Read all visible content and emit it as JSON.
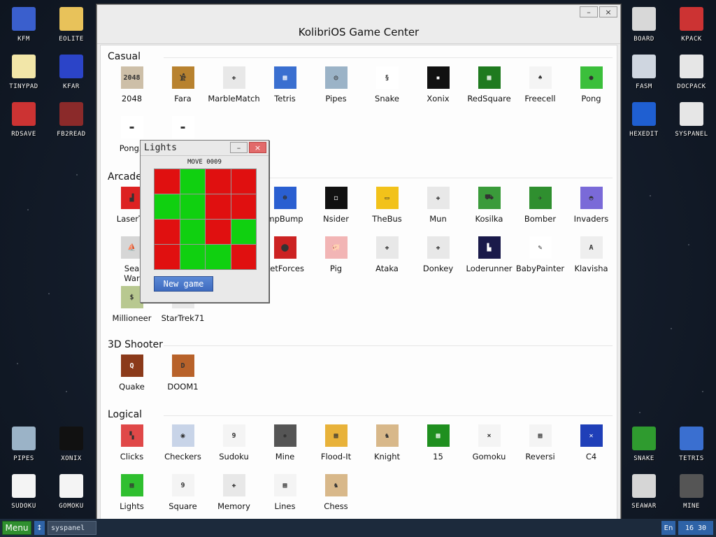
{
  "desktop": {
    "left_icons": [
      {
        "label": "KFM",
        "icon": "floppy-icon",
        "color": "#3a5fcd"
      },
      {
        "label": "EOLITE",
        "icon": "folder-icon",
        "color": "#e8c25a"
      },
      {
        "label": "TINYPAD",
        "icon": "notepad-icon",
        "color": "#f2e6a8"
      },
      {
        "label": "KFAR",
        "icon": "kfar-icon",
        "color": "#2b44c8"
      },
      {
        "label": "RDSAVE",
        "icon": "rdsave-icon",
        "color": "#c33"
      },
      {
        "label": "FB2READ",
        "icon": "book-icon",
        "color": "#8b2a2a"
      },
      {
        "label": "PIPES",
        "icon": "pipes-icon",
        "color": "#9bb3c7"
      },
      {
        "label": "XONIX",
        "icon": "xonix-icon",
        "color": "#111"
      },
      {
        "label": "SUDOKU",
        "icon": "sudoku-icon",
        "color": "#f4f4f4"
      },
      {
        "label": "GOMOKU",
        "icon": "gomoku-icon",
        "color": "#f4f4f4"
      }
    ],
    "right_icons": [
      {
        "label": "BOARD",
        "icon": "board-icon",
        "color": "#d8d8d8"
      },
      {
        "label": "KPACK",
        "icon": "hammer-icon",
        "color": "#c33"
      },
      {
        "label": "FASM",
        "icon": "fasm-icon",
        "color": "#cfd6e0"
      },
      {
        "label": "DOCPACK",
        "icon": "docpack-icon",
        "color": "#e6e6e6"
      },
      {
        "label": "HEXEDIT",
        "icon": "hexedit-icon",
        "color": "#1f5fd1"
      },
      {
        "label": "SYSPANEL",
        "icon": "syspanel-icon",
        "color": "#e6e6e6"
      },
      {
        "label": "SNAKE",
        "icon": "snake-icon",
        "color": "#2f9b2f"
      },
      {
        "label": "TETRIS",
        "icon": "tetris-icon",
        "color": "#3a6fd0"
      },
      {
        "label": "SEAWAR",
        "icon": "seawar-icon",
        "color": "#d6d6d6"
      },
      {
        "label": "MINE",
        "icon": "mine-icon",
        "color": "#555"
      }
    ]
  },
  "game_center": {
    "title": "KolibriOS Game Center",
    "window_buttons": {
      "minimize": "–",
      "close": "×"
    },
    "sections": [
      {
        "title": "Casual",
        "apps": [
          {
            "label": "2048",
            "icon": "2048-icon",
            "color": "#cdbfa8",
            "glyph": "2048"
          },
          {
            "label": "Fara",
            "icon": "fara-icon",
            "color": "#b8822f",
            "glyph": "𓀀"
          },
          {
            "label": "MarbleMatch",
            "icon": "gamepad-icon",
            "color": "#e8e8e8",
            "glyph": "✚"
          },
          {
            "label": "Tetris",
            "icon": "tetris-icon",
            "color": "#3a6fd0",
            "glyph": "▦"
          },
          {
            "label": "Pipes",
            "icon": "pipes-icon",
            "color": "#9bb3c7",
            "glyph": "◎"
          },
          {
            "label": "Snake",
            "icon": "snake-icon",
            "color": "#ffffff",
            "glyph": "§"
          },
          {
            "label": "Xonix",
            "icon": "xonix-icon",
            "color": "#111111",
            "glyph": "▪"
          },
          {
            "label": "RedSquare",
            "icon": "redsquare-icon",
            "color": "#1f7a1f",
            "glyph": "▩"
          },
          {
            "label": "Freecell",
            "icon": "cards-icon",
            "color": "#f4f4f4",
            "glyph": "♠"
          },
          {
            "label": "Pong",
            "icon": "ball-icon",
            "color": "#3bbf3b",
            "glyph": "●"
          },
          {
            "label": "Pong3",
            "icon": "paddle-icon",
            "color": "#ffffff",
            "glyph": "▬"
          },
          {
            "label": "",
            "icon": "paddle-icon",
            "color": "#ffffff",
            "glyph": "▬"
          }
        ]
      },
      {
        "title": "Arcade",
        "apps": [
          {
            "label": "LaserTa",
            "icon": "tank-icon",
            "color": "#d22",
            "glyph": "▟"
          },
          {
            "label": "",
            "icon": "blank-icon",
            "color": "#ffffff",
            "glyph": ""
          },
          {
            "label": "",
            "icon": "blank-icon",
            "color": "#ffffff",
            "glyph": ""
          },
          {
            "label": "mpBump",
            "icon": "bump-icon",
            "color": "#2a5fd1",
            "glyph": "☻"
          },
          {
            "label": "Nsider",
            "icon": "nsider-icon",
            "color": "#111111",
            "glyph": "◻"
          },
          {
            "label": "TheBus",
            "icon": "bus-icon",
            "color": "#f2c21a",
            "glyph": "▭"
          },
          {
            "label": "Mun",
            "icon": "gamepad-icon",
            "color": "#e8e8e8",
            "glyph": "✚"
          },
          {
            "label": "Kosilka",
            "icon": "mower-icon",
            "color": "#3a9b3a",
            "glyph": "⛟"
          },
          {
            "label": "Bomber",
            "icon": "plane-icon",
            "color": "#2f8f2f",
            "glyph": "✈"
          },
          {
            "label": "Invaders",
            "icon": "ufo-icon",
            "color": "#7a6ad8",
            "glyph": "◓"
          },
          {
            "label": "Sea\nWar",
            "icon": "ship-icon",
            "color": "#d6d6d6",
            "glyph": "⛵"
          },
          {
            "label": "",
            "icon": "blank-icon",
            "color": "#ffffff",
            "glyph": ""
          },
          {
            "label": "",
            "icon": "blank-icon",
            "color": "#ffffff",
            "glyph": ""
          },
          {
            "label": "ketForces",
            "icon": "rocket-icon",
            "color": "#c22",
            "glyph": "⬤"
          },
          {
            "label": "Pig",
            "icon": "pig-icon",
            "color": "#f2b5b5",
            "glyph": "🐖"
          },
          {
            "label": "Ataka",
            "icon": "gamepad-icon",
            "color": "#e8e8e8",
            "glyph": "✚"
          },
          {
            "label": "Donkey",
            "icon": "gamepad-icon",
            "color": "#e8e8e8",
            "glyph": "✚"
          },
          {
            "label": "Loderunner",
            "icon": "loderunner-icon",
            "color": "#1a1a4a",
            "glyph": "▙"
          },
          {
            "label": "BabyPainter",
            "icon": "brush-icon",
            "color": "#ffffff",
            "glyph": "✎"
          },
          {
            "label": "Klavisha",
            "icon": "key-icon",
            "color": "#eeeeee",
            "glyph": "A"
          },
          {
            "label": "Millioneer",
            "icon": "money-icon",
            "color": "#b8c890",
            "glyph": "$"
          },
          {
            "label": "StarTrek71",
            "icon": "startrek-icon",
            "color": "#e8e8e8",
            "glyph": "✦"
          }
        ]
      },
      {
        "title": "3D Shooter",
        "apps": [
          {
            "label": "Quake",
            "icon": "quake-icon",
            "color": "#8b3a1a",
            "glyph": "Q"
          },
          {
            "label": "DOOM1",
            "icon": "doom-icon",
            "color": "#b8622a",
            "glyph": "D"
          }
        ]
      },
      {
        "title": "Logical",
        "apps": [
          {
            "label": "Clicks",
            "icon": "clicks-icon",
            "color": "#e04848",
            "glyph": "▚"
          },
          {
            "label": "Checkers",
            "icon": "checkers-icon",
            "color": "#c8d4e8",
            "glyph": "◉"
          },
          {
            "label": "Sudoku",
            "icon": "sudoku-icon",
            "color": "#f4f4f4",
            "glyph": "9"
          },
          {
            "label": "Mine",
            "icon": "mine-icon",
            "color": "#555555",
            "glyph": "✹"
          },
          {
            "label": "Flood-It",
            "icon": "flood-icon",
            "color": "#e8b23a",
            "glyph": "▦"
          },
          {
            "label": "Knight",
            "icon": "knight-icon",
            "color": "#d8b88a",
            "glyph": "♞"
          },
          {
            "label": "15",
            "icon": "fifteen-icon",
            "color": "#1f8f1f",
            "glyph": "▦"
          },
          {
            "label": "Gomoku",
            "icon": "gomoku-icon",
            "color": "#f4f4f4",
            "glyph": "⨯"
          },
          {
            "label": "Reversi",
            "icon": "reversi-icon",
            "color": "#f4f4f4",
            "glyph": "▦"
          },
          {
            "label": "C4",
            "icon": "c4-icon",
            "color": "#1f3fb8",
            "glyph": "✕"
          },
          {
            "label": "Lights",
            "icon": "lights-icon",
            "color": "#2fbf2f",
            "glyph": "▦"
          },
          {
            "label": "Square",
            "icon": "square-icon",
            "color": "#f4f4f4",
            "glyph": "9"
          },
          {
            "label": "Memory",
            "icon": "gamepad-icon",
            "color": "#e8e8e8",
            "glyph": "✚"
          },
          {
            "label": "Lines",
            "icon": "lines-icon",
            "color": "#f4f4f4",
            "glyph": "▦"
          },
          {
            "label": "Chess",
            "icon": "chess-icon",
            "color": "#d8b88a",
            "glyph": "♞"
          }
        ]
      }
    ]
  },
  "lights_window": {
    "title": "Lights",
    "window_buttons": {
      "minimize": "–",
      "close": "×"
    },
    "move_label": "MOVE 0009",
    "new_game_label": "New game",
    "colors": {
      "on": "#e01010",
      "off": "#10d010"
    },
    "grid": [
      [
        "red",
        "green",
        "red",
        "red"
      ],
      [
        "green",
        "green",
        "red",
        "red"
      ],
      [
        "red",
        "green",
        "red",
        "green"
      ],
      [
        "red",
        "green",
        "green",
        "red"
      ]
    ]
  },
  "taskbar": {
    "menu_label": "Menu",
    "arrow_icon": "↕",
    "task_label": "syspanel",
    "language": "En",
    "clock": "16 30"
  }
}
